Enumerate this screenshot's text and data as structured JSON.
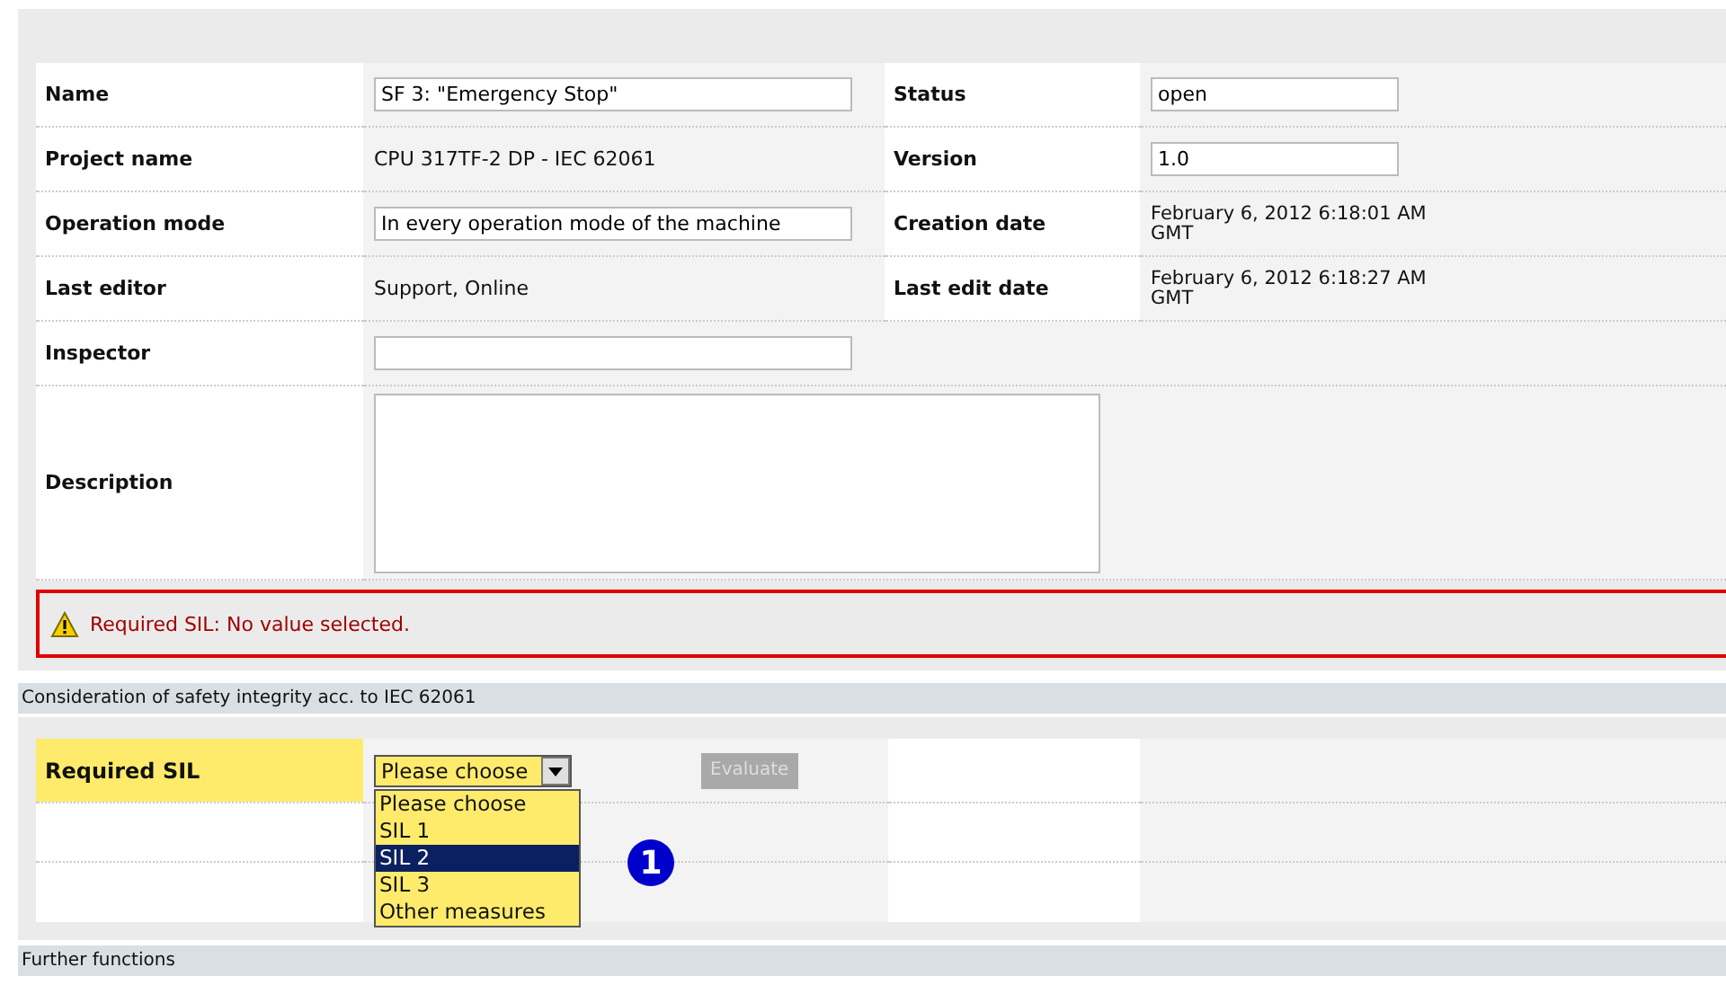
{
  "form": {
    "rows": [
      {
        "fields": [
          {
            "label": "Name",
            "kind": "input",
            "value": "SF 3: \"Emergency Stop\""
          },
          {
            "label": "Status",
            "kind": "input",
            "value": "open"
          }
        ]
      },
      {
        "fields": [
          {
            "label": "Project name",
            "kind": "text",
            "value": "CPU 317TF-2 DP - IEC 62061"
          },
          {
            "label": "Version",
            "kind": "input",
            "value": "1.0"
          }
        ]
      },
      {
        "fields": [
          {
            "label": "Operation mode",
            "kind": "input",
            "value": "In every operation mode of the machine"
          },
          {
            "label": "Creation date",
            "kind": "text",
            "value": "February 6, 2012 6:18:01 AM\nGMT"
          }
        ]
      },
      {
        "fields": [
          {
            "label": "Last editor",
            "kind": "text",
            "value": "Support, Online"
          },
          {
            "label": "Last edit date",
            "kind": "text",
            "value": "February 6, 2012 6:18:27 AM\nGMT"
          }
        ]
      },
      {
        "fields": [
          {
            "label": "Inspector",
            "kind": "input"
          }
        ]
      },
      {
        "fields": [
          {
            "label": "Description",
            "kind": "textarea"
          }
        ]
      }
    ]
  },
  "warning": {
    "text": "Required SIL: No value selected."
  },
  "sections": [
    {
      "title": "Consideration of safety integrity acc. to IEC 62061"
    },
    {
      "title": "Further functions"
    }
  ],
  "sil": {
    "label": "Required SIL",
    "select_value": "Please choose",
    "button": "Evaluate",
    "button_disabled": true,
    "options": [
      {
        "label": "Please choose",
        "selected": false
      },
      {
        "label": "SIL 1",
        "selected": false
      },
      {
        "label": "SIL 2",
        "selected": true
      },
      {
        "label": "SIL 3",
        "selected": false
      },
      {
        "label": "Other measures",
        "selected": false
      }
    ],
    "callout": "1"
  }
}
